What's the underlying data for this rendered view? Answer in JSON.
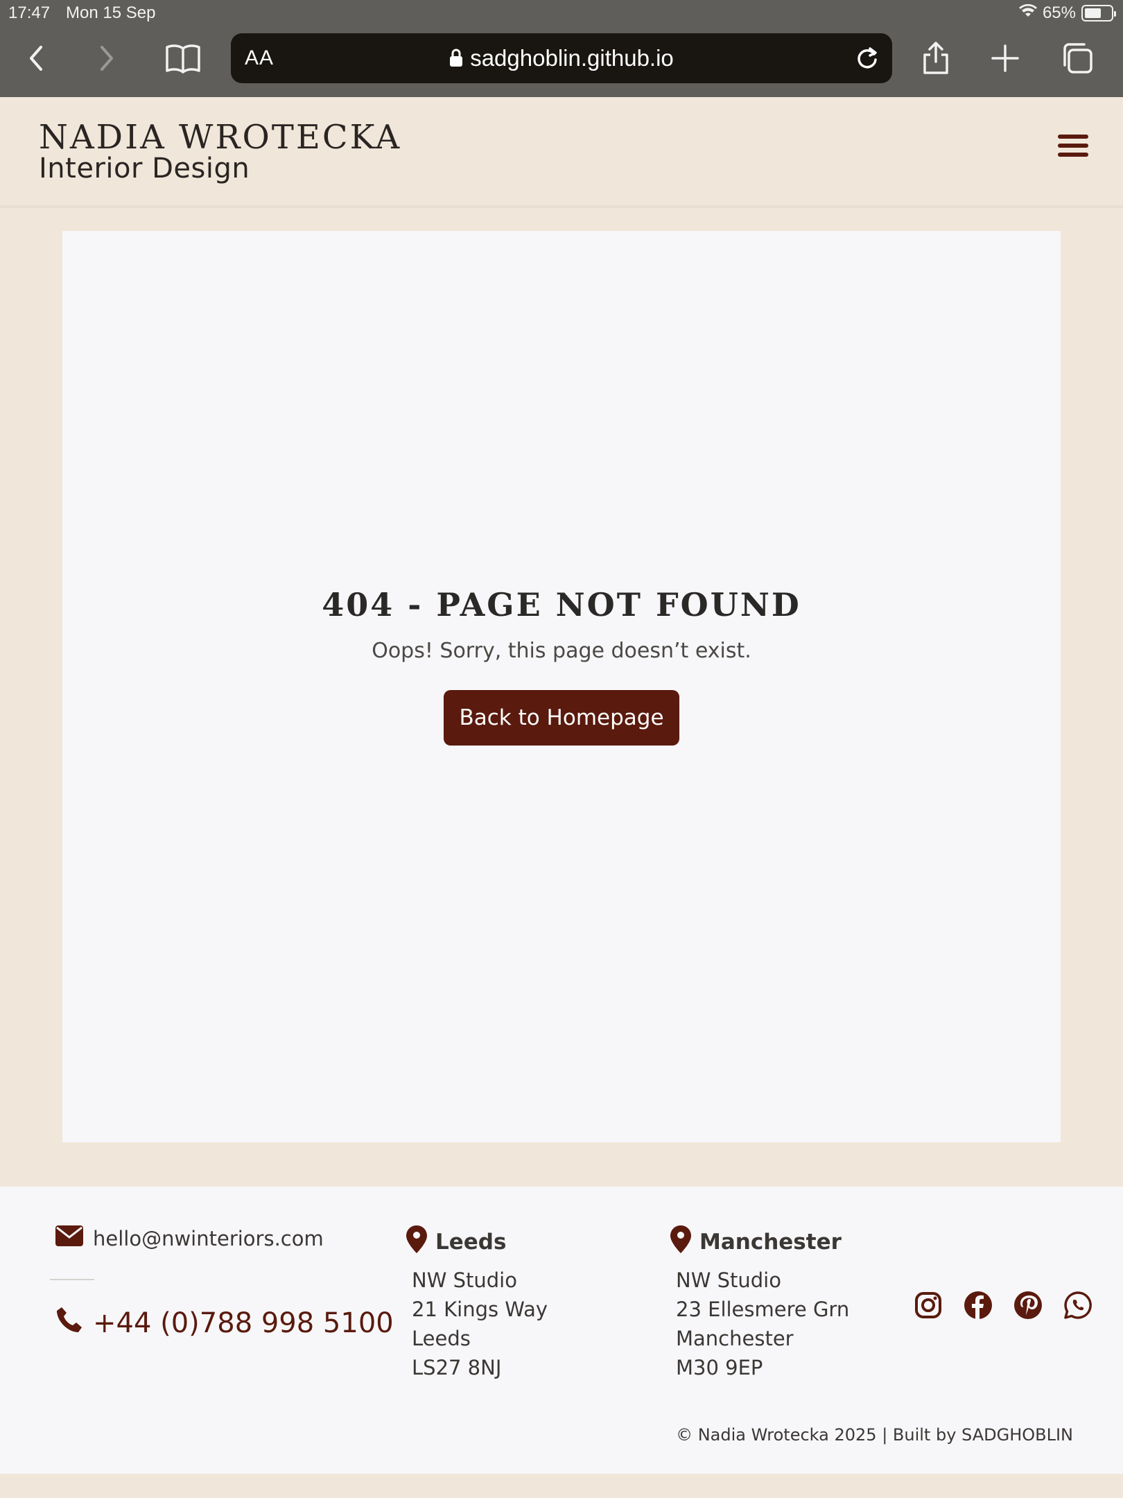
{
  "status_bar": {
    "time": "17:47",
    "date": "Mon 15 Sep",
    "battery_percent": "65%",
    "battery_level": 0.65
  },
  "browser": {
    "text_size_label": "AA",
    "url_host": "sadghoblin.github.io"
  },
  "site": {
    "brand_name": "NADIA WROTECKA",
    "brand_subtitle": "Interior Design"
  },
  "error_page": {
    "title": "404 - PAGE NOT FOUND",
    "message": "Oops! Sorry, this page doesn’t exist.",
    "button_label": "Back to Homepage"
  },
  "footer": {
    "email": "hello@nwinteriors.com",
    "phone": "+44 (0)788 998 5100",
    "locations": [
      {
        "city": "Leeds",
        "lines": [
          "NW Studio",
          "21 Kings Way",
          "Leeds",
          "LS27 8NJ"
        ]
      },
      {
        "city": "Manchester",
        "lines": [
          "NW Studio",
          "23 Ellesmere Grn",
          "Manchester",
          "M30 9EP"
        ]
      }
    ],
    "social_icons": [
      "instagram-icon",
      "facebook-icon",
      "pinterest-icon",
      "whatsapp-icon"
    ],
    "copyright": "© Nadia Wrotecka 2025  |  Built by SADGHOBLIN"
  },
  "colors": {
    "accent": "#5a1a0e",
    "page_background": "#f0e7da",
    "card_background": "#f7f7f9",
    "browser_chrome": "#5f5e5a"
  }
}
